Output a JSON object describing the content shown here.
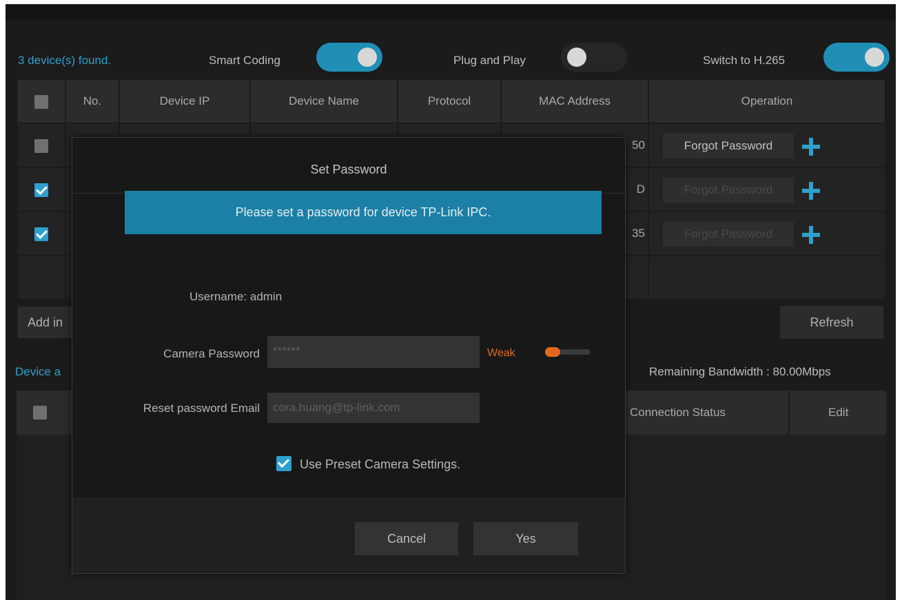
{
  "topbar": {
    "devices_found": "3 device(s) found.",
    "smart_coding_label": "Smart Coding",
    "plug_and_play_label": "Plug and Play",
    "switch_h265_label": "Switch to H.265",
    "smart_coding_on": true,
    "plug_and_play_on": false,
    "switch_h265_on": true
  },
  "device_table": {
    "columns": [
      "No.",
      "Device IP",
      "Device Name",
      "Protocol",
      "MAC Address",
      "Operation"
    ],
    "rows": [
      {
        "checked": false,
        "mac_tail": "50",
        "forgot_label": "Forgot Password"
      },
      {
        "checked": true,
        "mac_tail": "D",
        "forgot_label": "Forgot Password"
      },
      {
        "checked": true,
        "mac_tail": "35",
        "forgot_label": "Forgot Password"
      }
    ]
  },
  "actions": {
    "add_label": "Add in",
    "refresh_label": "Refresh"
  },
  "added_section": {
    "title": "Device a",
    "remaining_bandwidth": "Remaining Bandwidth : 80.00Mbps",
    "columns": [
      "Connection Status",
      "Edit"
    ]
  },
  "dialog": {
    "title": "Set Password",
    "banner": "Please set a password for device TP-Link IPC.",
    "username_text": "Username: admin",
    "password_label": "Camera Password",
    "password_value": "******",
    "strength_label": "Weak",
    "email_label": "Reset password Email",
    "email_value": "cora.huang@tp-link.com",
    "preset_label": "Use Preset Camera Settings.",
    "preset_checked": true,
    "cancel_label": "Cancel",
    "yes_label": "Yes"
  },
  "colors": {
    "accent": "#1f8fb5",
    "banner": "#1b7fa6",
    "weak": "#e0691f",
    "background": "#1b1b1b"
  }
}
